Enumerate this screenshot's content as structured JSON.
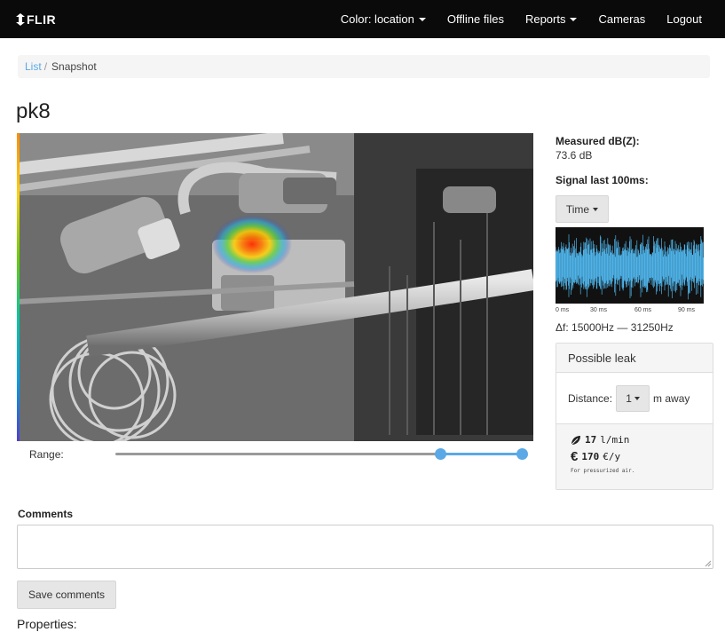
{
  "navbar": {
    "brand": "FLIR",
    "items": [
      {
        "label": "Color: location",
        "dropdown": true
      },
      {
        "label": "Offline files",
        "dropdown": false
      },
      {
        "label": "Reports",
        "dropdown": true
      },
      {
        "label": "Cameras",
        "dropdown": false
      },
      {
        "label": "Logout",
        "dropdown": false
      }
    ]
  },
  "breadcrumb": {
    "link": "List",
    "separator": "/",
    "current": "Snapshot"
  },
  "page_title": "pk8",
  "range": {
    "label": "Range:",
    "low": 0.8,
    "high": 1.0
  },
  "measurement": {
    "title": "Measured dB(Z):",
    "value": "73.6 dB"
  },
  "signal": {
    "title": "Signal last 100ms:",
    "mode_button": "Time",
    "ticks": [
      "0 ms",
      "30 ms",
      "60 ms",
      "90 ms"
    ],
    "frequency_range": "Δf: 15000Hz — 31250Hz",
    "wave_color": "#4fb3e8"
  },
  "leak": {
    "title": "Possible leak",
    "distance_label": "Distance:",
    "distance_value": "1",
    "distance_suffix": "m away",
    "flow_value": "17",
    "flow_unit": "l/min",
    "cost_value": "170",
    "cost_unit": "€/y",
    "note": "For pressurized air."
  },
  "comments": {
    "label": "Comments",
    "value": "",
    "save_button": "Save comments"
  },
  "properties_label": "Properties:",
  "colors": {
    "accent": "#5aa9e6",
    "navbar": "#0a0a0a"
  }
}
